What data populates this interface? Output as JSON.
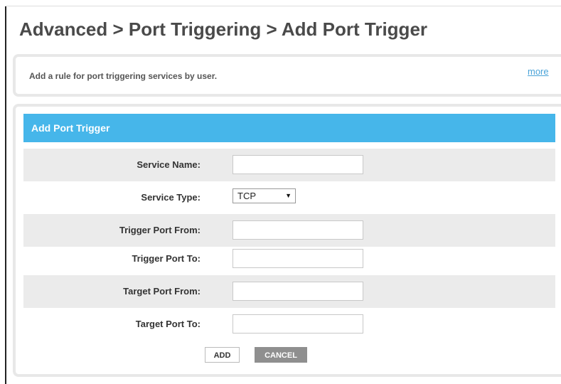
{
  "page": {
    "title": "Advanced > Port Triggering > Add Port Trigger"
  },
  "info": {
    "text": "Add a rule for port triggering services by user.",
    "more_link": "more"
  },
  "form": {
    "header": "Add Port Trigger",
    "service_name": {
      "label": "Service Name:",
      "value": ""
    },
    "service_type": {
      "label": "Service Type:",
      "selected": "TCP"
    },
    "trigger_port_from": {
      "label": "Trigger Port From:",
      "value": ""
    },
    "trigger_port_to": {
      "label": "Trigger Port To:",
      "value": ""
    },
    "target_port_from": {
      "label": "Target Port From:",
      "value": ""
    },
    "target_port_to": {
      "label": "Target Port To:",
      "value": ""
    }
  },
  "buttons": {
    "add": "ADD",
    "cancel": "CANCEL"
  },
  "colors": {
    "header_bg": "#46b6ea",
    "link": "#4aa3d8",
    "row_shade": "#ebebeb",
    "cancel_bg": "#8f8f8f"
  }
}
